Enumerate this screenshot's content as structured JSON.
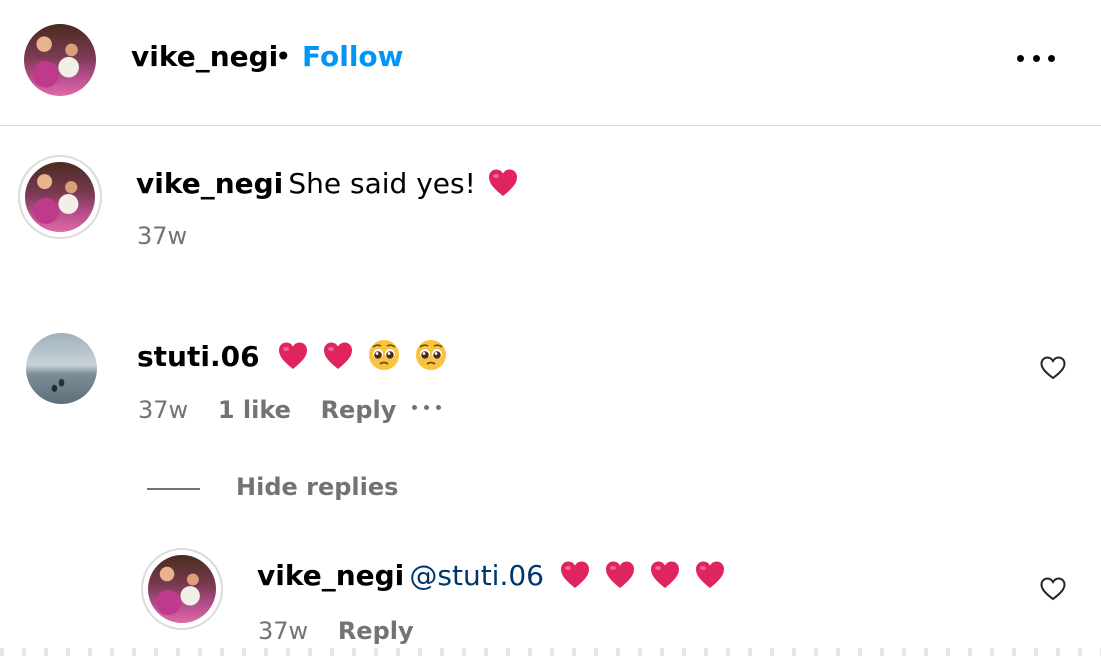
{
  "post": {
    "author": "vike_negi",
    "separator": "•",
    "follow_label": "Follow",
    "more_icon": "more-horizontal-icon"
  },
  "caption": {
    "username": "vike_negi",
    "text": "She said yes!",
    "emoji": "red-heart",
    "time": "37w"
  },
  "comments": [
    {
      "username": "stuti.06",
      "emojis": [
        "red-heart",
        "red-heart",
        "pleading-face",
        "pleading-face"
      ],
      "time": "37w",
      "likes": "1 like",
      "reply_label": "Reply"
    }
  ],
  "hide_replies_label": "Hide replies",
  "replies": [
    {
      "username": "vike_negi",
      "mention": "@stuti.06",
      "emojis": [
        "red-heart",
        "red-heart",
        "red-heart",
        "red-heart"
      ],
      "time": "37w",
      "reply_label": "Reply"
    }
  ],
  "colors": {
    "follow": "#0095f6",
    "mention": "#00376b",
    "meta": "#737373",
    "heart": "#e0245e",
    "divider": "#dbdbdb"
  }
}
